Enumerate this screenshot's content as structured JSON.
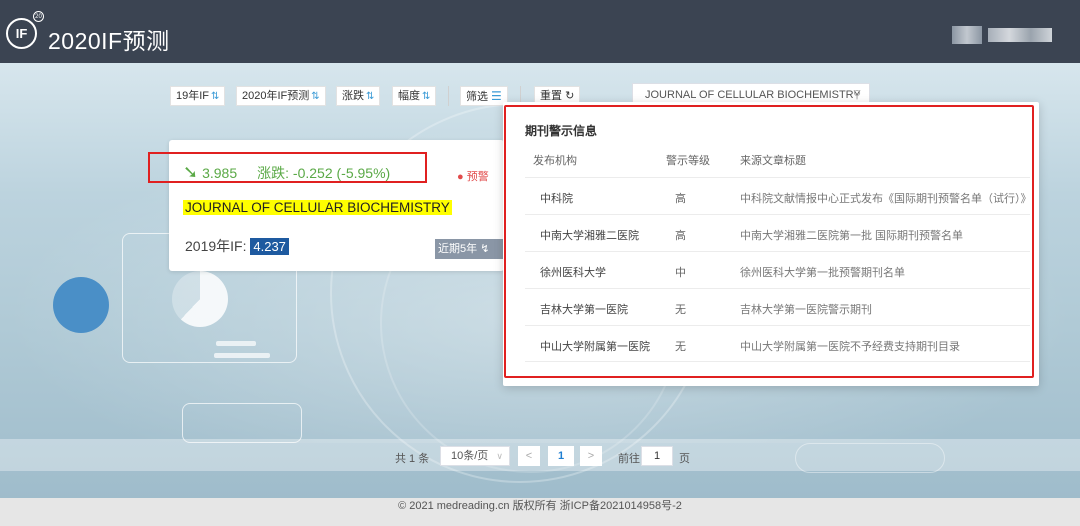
{
  "header": {
    "logo_text": "IF",
    "logo_sup": "20",
    "title": "2020IF预测"
  },
  "toolbar": {
    "if19": "19年IF",
    "if2020": "2020年IF预测",
    "change": "涨跌",
    "range": "幅度",
    "filter": "筛选",
    "reset": "重置",
    "sort_arrow": "⇅",
    "reset_icon": "↻",
    "filter_icon": "☰"
  },
  "search": {
    "value": "JOURNAL OF CELLULAR BIOCHEMISTRY",
    "icon": "search-icon"
  },
  "card": {
    "arrow": "➘",
    "predicted_if": "3.985",
    "change_text": "涨跌: -0.252 (-5.95%)",
    "warning_label": "预警",
    "journal_name": "JOURNAL OF CELLULAR BIOCHEMISTRY",
    "if2019_label": "2019年IF:",
    "if2019_value": "4.237",
    "recent_label": "近期5年",
    "trend_color": "#5aa946",
    "warning_color": "#e24c4c"
  },
  "popup": {
    "title": "期刊警示信息",
    "headers": [
      "发布机构",
      "警示等级",
      "来源文章标题"
    ],
    "rows": [
      {
        "org": "中科院",
        "level": "高",
        "source": "中科院文献情报中心正式发布《国际期刊预警名单（试行）》"
      },
      {
        "org": "中南大学湘雅二医院",
        "level": "高",
        "source": "中南大学湘雅二医院第一批 国际期刊预警名单"
      },
      {
        "org": "徐州医科大学",
        "level": "中",
        "source": "徐州医科大学第一批预警期刊名单"
      },
      {
        "org": "吉林大学第一医院",
        "level": "无",
        "source": "吉林大学第一医院警示期刊"
      },
      {
        "org": "中山大学附属第一医院",
        "level": "无",
        "source": "中山大学附属第一医院不予经费支持期刊目录"
      }
    ]
  },
  "pagination": {
    "total": "共 1 条",
    "page_size": "10条/页",
    "prev": "<",
    "current": "1",
    "next": ">",
    "goto_label": "前往",
    "goto_value": "1",
    "page_suffix": "页"
  },
  "footer": {
    "text": "© 2021 medreading.cn 版权所有 浙ICP备2021014958号-2"
  }
}
